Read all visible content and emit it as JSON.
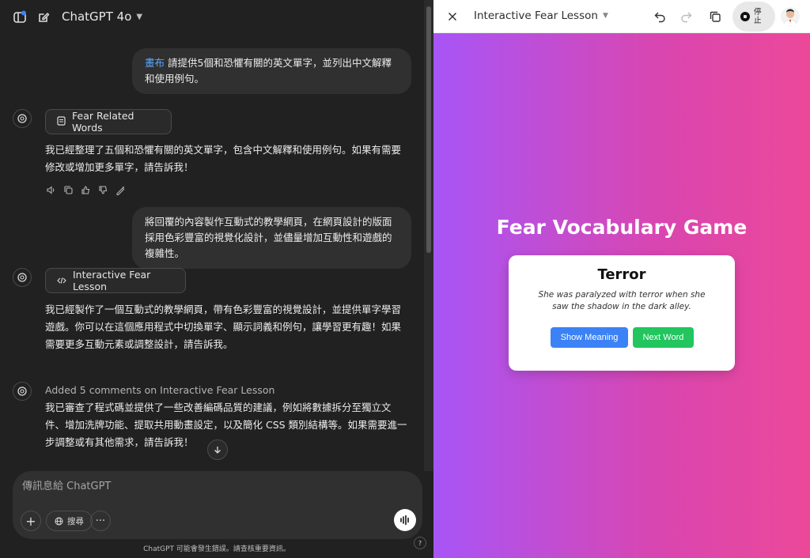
{
  "header": {
    "model_name": "ChatGPT 4o"
  },
  "conversation": {
    "user_message_1": {
      "mention": "畫布",
      "text": " 請提供5個和恐懼有關的英文單字，並列出中文解釋和使用例句。"
    },
    "assistant_1": {
      "chip_label": "Fear Related Words",
      "text": "我已經整理了五個和恐懼有關的英文單字，包含中文解釋和使用例句。如果有需要修改或增加更多單字，請告訴我！"
    },
    "user_message_2": {
      "text": "將回覆的內容製作互動式的教學網頁，在網頁設計的版面採用色彩豐富的視覺化設計，並儘量增加互動性和遊戲的複雜性。"
    },
    "assistant_2": {
      "chip_label": "Interactive Fear Lesson",
      "text": "我已經製作了一個互動式的教學網頁，帶有色彩豐富的視覺設計，並提供單字學習遊戲。你可以在這個應用程式中切換單字、顯示詞義和例句，讓學習更有趣！如果需要更多互動元素或調整設計，請告訴我。"
    },
    "assistant_3": {
      "comment_line": "Added 5 comments on Interactive Fear Lesson",
      "text": "我已審查了程式碼並提供了一些改善編碼品質的建議，例如將數據拆分至獨立文件、增加洗牌功能、提取共用動畫設定，以及簡化 CSS 類別結構等。如果需要進一步調整或有其他需求，請告訴我！"
    }
  },
  "composer": {
    "placeholder": "傳訊息給 ChatGPT",
    "search_label": "搜尋",
    "disclaimer": "ChatGPT 可能會發生錯誤。請查核重要資訊。",
    "help_label": "?"
  },
  "canvas": {
    "title": "Interactive Fear Lesson",
    "stop_label": "停止"
  },
  "game": {
    "title": "Fear Vocabulary Game",
    "word": "Terror",
    "example": "She was paralyzed with terror when she saw the shadow in the dark alley.",
    "show_meaning_label": "Show Meaning",
    "next_word_label": "Next Word"
  },
  "colors": {
    "mention_link": "#5aa8ff",
    "gradient_start": "#a855f7",
    "gradient_end": "#ec4899",
    "show_meaning_button": "#3b82f6",
    "next_word_button": "#22c55e"
  }
}
